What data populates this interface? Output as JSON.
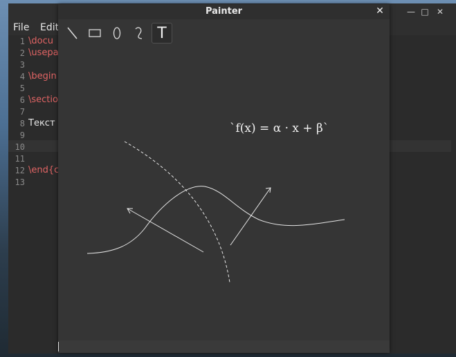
{
  "editor": {
    "menu": [
      "File",
      "Edit"
    ],
    "lines": [
      {
        "num": "1",
        "text": "\\docu"
      },
      {
        "num": "2",
        "text": "\\usepa"
      },
      {
        "num": "3",
        "text": ""
      },
      {
        "num": "4",
        "text": "\\begin"
      },
      {
        "num": "5",
        "text": ""
      },
      {
        "num": "6",
        "text": "\\sectio"
      },
      {
        "num": "7",
        "text": ""
      },
      {
        "num": "8",
        "text": "Текст"
      },
      {
        "num": "9",
        "text": ""
      },
      {
        "num": "10",
        "text": ""
      },
      {
        "num": "11",
        "text": ""
      },
      {
        "num": "12",
        "text": "\\end{c"
      },
      {
        "num": "13",
        "text": ""
      }
    ],
    "window_controls": {
      "close": "✕",
      "maximize": "□",
      "minimize": "—"
    }
  },
  "painter": {
    "title": "Painter",
    "close_glyph": "✕",
    "tools": [
      {
        "name": "line-tool",
        "icon": "line-icon"
      },
      {
        "name": "rectangle-tool",
        "icon": "rectangle-icon"
      },
      {
        "name": "ellipse-tool",
        "icon": "ellipse-icon"
      },
      {
        "name": "curve-tool",
        "icon": "curve-icon"
      },
      {
        "name": "text-tool",
        "icon": "text-icon",
        "label": "T",
        "active": true
      }
    ],
    "formula": "`f(x) = α · x + β`",
    "stroke_color": "#e8e8e8"
  }
}
